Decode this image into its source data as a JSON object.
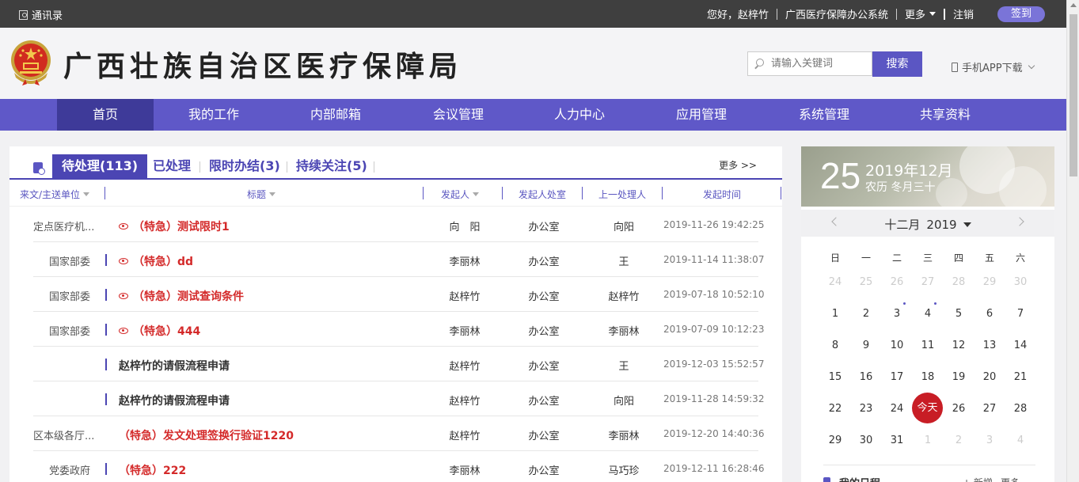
{
  "topbar": {
    "contacts": "通讯录",
    "greeting": "您好，赵梓竹",
    "system": "广西医疗保障办公系统",
    "more": "更多",
    "logout": "注销",
    "signin": "签到"
  },
  "header": {
    "site_name": "广西壮族自治区医疗保障局",
    "search_placeholder": "请输入关键词",
    "search_button": "搜索",
    "app_download": "手机APP下载"
  },
  "nav": {
    "items": [
      "首页",
      "我的工作",
      "内部邮箱",
      "会议管理",
      "人力中心",
      "应用管理",
      "系统管理",
      "共享资料"
    ],
    "active": "首页"
  },
  "tabs": {
    "pending": "待处理(113)",
    "done": "已处理",
    "limited": "限时办结(3)",
    "follow": "持续关注(5)",
    "more": "更多 >>"
  },
  "table": {
    "headers": {
      "unit": "来文/主送单位",
      "title": "标题",
      "sender": "发起人",
      "dept": "发起人处室",
      "prev": "上一处理人",
      "time": "发起时间"
    },
    "rows": [
      {
        "unit": "定点医疗机...",
        "title": "（特急）测试限时1",
        "urgent": true,
        "viewed": true,
        "sender": "向　阳",
        "dept": "办公室",
        "prev": "向阳",
        "time": "2019-11-26 19:42:25"
      },
      {
        "unit": "国家部委",
        "title": "（特急）dd",
        "urgent": true,
        "viewed": true,
        "sender": "李丽林",
        "dept": "办公室",
        "prev": "王",
        "time": "2019-11-14 11:38:07"
      },
      {
        "unit": "国家部委",
        "title": "（特急）测试查询条件",
        "urgent": true,
        "viewed": true,
        "sender": "赵梓竹",
        "dept": "办公室",
        "prev": "赵梓竹",
        "time": "2019-07-18 10:52:10"
      },
      {
        "unit": "国家部委",
        "title": "（特急）444",
        "urgent": true,
        "viewed": true,
        "sender": "李丽林",
        "dept": "办公室",
        "prev": "李丽林",
        "time": "2019-07-09 10:12:23"
      },
      {
        "unit": "",
        "title": "赵梓竹的请假流程申请",
        "urgent": false,
        "viewed": false,
        "sender": "赵梓竹",
        "dept": "办公室",
        "prev": "王",
        "time": "2019-12-03 15:52:57"
      },
      {
        "unit": "",
        "title": "赵梓竹的请假流程申请",
        "urgent": false,
        "viewed": false,
        "sender": "赵梓竹",
        "dept": "办公室",
        "prev": "向阳",
        "time": "2019-11-28 14:59:32"
      },
      {
        "unit": "区本级各厅...",
        "title": "（特急）发文处理签换行验证1220",
        "urgent": true,
        "viewed": false,
        "sender": "赵梓竹",
        "dept": "办公室",
        "prev": "李丽林",
        "time": "2019-12-20 14:40:36"
      },
      {
        "unit": "党委政府",
        "title": "（特急）222",
        "urgent": true,
        "viewed": false,
        "sender": "李丽林",
        "dept": "办公室",
        "prev": "马巧珍",
        "time": "2019-12-11 16:28:46"
      }
    ]
  },
  "calendar": {
    "day": "25",
    "year_month": "2019年12月",
    "lunar": "农历 冬月三十",
    "month_label": "十二月",
    "year_label": "2019",
    "weekdays": [
      "日",
      "一",
      "二",
      "三",
      "四",
      "五",
      "六"
    ],
    "weeks": [
      [
        "24",
        "25",
        "26",
        "27",
        "28",
        "29",
        "30"
      ],
      [
        "1",
        "2",
        "3",
        "4",
        "5",
        "6",
        "7"
      ],
      [
        "8",
        "9",
        "10",
        "11",
        "12",
        "13",
        "14"
      ],
      [
        "15",
        "16",
        "17",
        "18",
        "19",
        "20",
        "21"
      ],
      [
        "22",
        "23",
        "24",
        "今天",
        "26",
        "27",
        "28"
      ],
      [
        "29",
        "30",
        "31",
        "1",
        "2",
        "3",
        "4"
      ]
    ],
    "schedule_title": "我的日程",
    "schedule_add": "+ 新增",
    "schedule_more": "更多"
  },
  "colors": {
    "nav": "#5f58c8",
    "nav_active": "#3e3a99",
    "accent": "#4b45b3",
    "urgent": "#d42a2a",
    "today": "#c81d25",
    "topbar": "#3f3f3f"
  }
}
